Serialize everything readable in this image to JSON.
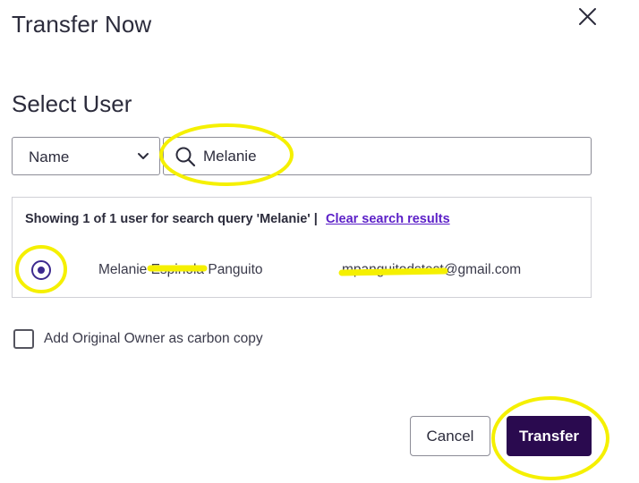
{
  "dialog": {
    "title": "Transfer Now",
    "close_icon": "close-icon"
  },
  "select_user": {
    "heading": "Select User",
    "field_select": {
      "value": "Name",
      "icon": "chevron-down-icon"
    },
    "search": {
      "value": "Melanie",
      "icon": "search-icon"
    }
  },
  "results": {
    "summary": "Showing 1 of 1 user for search query 'Melanie' |",
    "clear_link": "Clear search results",
    "rows": [
      {
        "selected": true,
        "name": "Melanie Espinola Panguito",
        "email": "mpanguitodstest@gmail.com"
      }
    ]
  },
  "carbon_copy": {
    "label": "Add Original Owner as carbon copy",
    "checked": false
  },
  "actions": {
    "cancel": "Cancel",
    "transfer": "Transfer"
  },
  "colors": {
    "primary": "#2a0a4f",
    "link": "#5b1fc7",
    "radio": "#3d2a8f",
    "highlight": "#f5f000"
  }
}
